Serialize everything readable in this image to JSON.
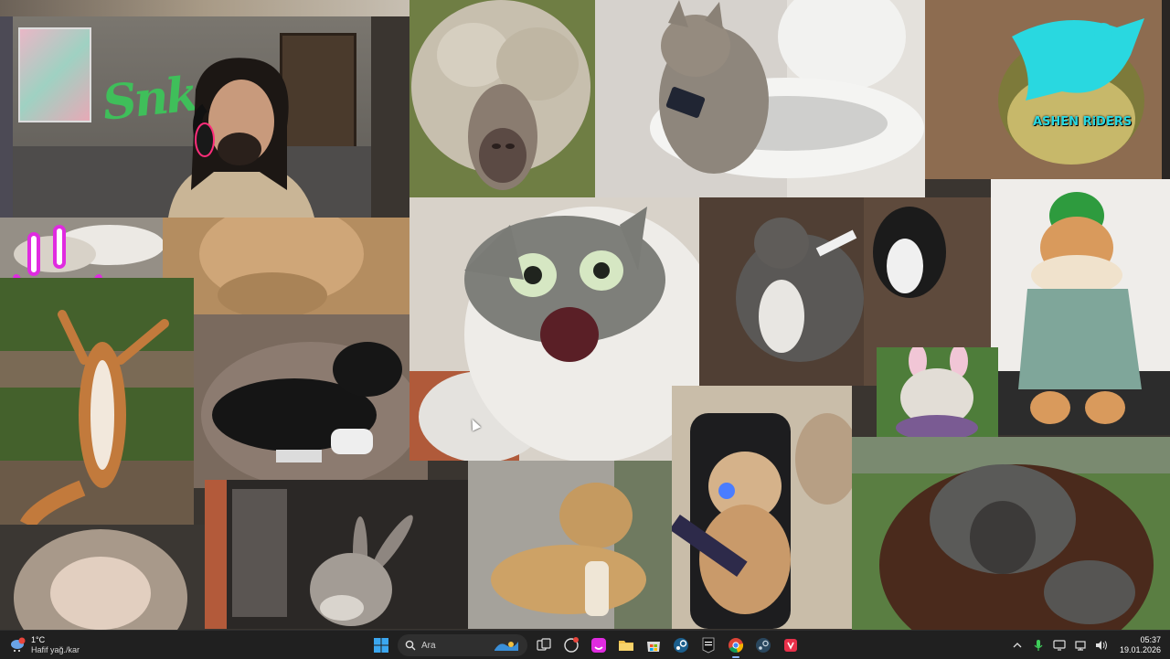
{
  "desktop": {
    "tiles": [
      {
        "subject": "sheep with curly fleece covering eyes"
      },
      {
        "subject": "cat sitting on toilet holding phone"
      },
      {
        "subject": "frog with Ashen Riders logo"
      },
      {
        "subject": "shocked cat screaming"
      },
      {
        "subject": "dog and cat fighting"
      },
      {
        "subject": "cat in green hat and shirt"
      },
      {
        "subject": "bulldog with bunny ears"
      },
      {
        "subject": "squirrel with arms raised"
      },
      {
        "subject": "black dog lying with game controller"
      },
      {
        "subject": "dog holding bread"
      },
      {
        "subject": "gamer cat with headset and keyboard"
      },
      {
        "subject": "orangutan"
      },
      {
        "subject": "donkey grinning"
      },
      {
        "subject": "monkey with eyes closed"
      },
      {
        "subject": "blurred cat close-up"
      },
      {
        "subject": "cat lying on carpet"
      }
    ],
    "logo_text": "ASHEN RiDERS",
    "webcam_sign_text": "Snko",
    "colors": {
      "cyan_logo": "#29d8e0",
      "streamer_sign": "#3fbf5a",
      "overlay_pink": "#e02be0"
    }
  },
  "taskbar": {
    "weather": {
      "temp": "1°C",
      "desc": "Hafif yağ./kar"
    },
    "search": {
      "label": "Ara"
    },
    "apps": [
      "windows-start",
      "search",
      "task-view",
      "chat",
      "app-pink",
      "file-explorer",
      "microsoft-store",
      "steam",
      "epic-games",
      "chrome",
      "steam-alt",
      "app-red"
    ],
    "clock": {
      "time": "05:37",
      "date": "19.01.2026"
    }
  }
}
